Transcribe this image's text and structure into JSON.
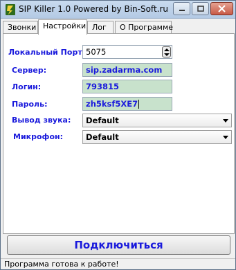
{
  "window": {
    "title": "SIP Killer 1.0 Powered by Bin-Soft.ru"
  },
  "tabs": [
    {
      "label": "Звонки",
      "active": false
    },
    {
      "label": "Настройки",
      "active": true
    },
    {
      "label": "Лог",
      "active": false
    },
    {
      "label": "О Программе",
      "active": false
    }
  ],
  "settings": {
    "local_port_label": "Локальный Порт:",
    "local_port_value": "5075",
    "server_label": "Сервер:",
    "server_value": "sip.zadarma.com",
    "login_label": "Логин:",
    "login_value": "793815",
    "password_label": "Пароль:",
    "password_value": "zh5ksf5XE7",
    "audio_out_label": "Вывод звука:",
    "audio_out_value": "Default",
    "mic_label": "Микрофон:",
    "mic_value": "Default"
  },
  "connect_button": "Подключиться",
  "status_text": "Программа готова к работе!",
  "colors": {
    "label_blue": "#1a1adc",
    "field_green": "#c8e2cc"
  }
}
